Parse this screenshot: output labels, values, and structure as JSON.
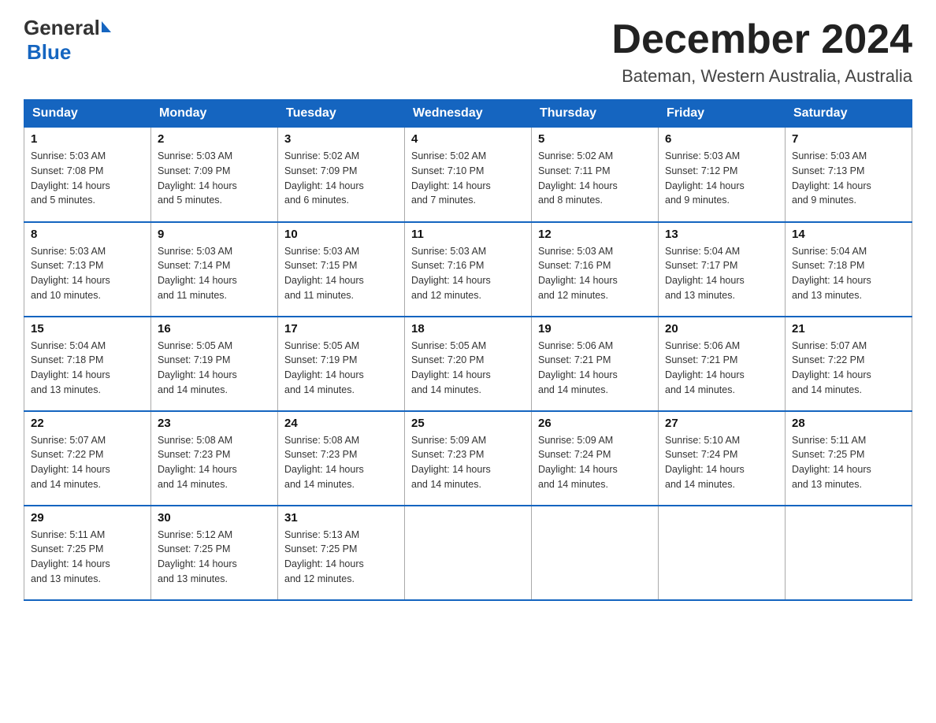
{
  "logo": {
    "general": "General",
    "blue": "Blue"
  },
  "header": {
    "month_title": "December 2024",
    "location": "Bateman, Western Australia, Australia"
  },
  "days_of_week": [
    "Sunday",
    "Monday",
    "Tuesday",
    "Wednesday",
    "Thursday",
    "Friday",
    "Saturday"
  ],
  "weeks": [
    [
      {
        "day": "1",
        "sunrise": "5:03 AM",
        "sunset": "7:08 PM",
        "daylight": "14 hours and 5 minutes."
      },
      {
        "day": "2",
        "sunrise": "5:03 AM",
        "sunset": "7:09 PM",
        "daylight": "14 hours and 5 minutes."
      },
      {
        "day": "3",
        "sunrise": "5:02 AM",
        "sunset": "7:09 PM",
        "daylight": "14 hours and 6 minutes."
      },
      {
        "day": "4",
        "sunrise": "5:02 AM",
        "sunset": "7:10 PM",
        "daylight": "14 hours and 7 minutes."
      },
      {
        "day": "5",
        "sunrise": "5:02 AM",
        "sunset": "7:11 PM",
        "daylight": "14 hours and 8 minutes."
      },
      {
        "day": "6",
        "sunrise": "5:03 AM",
        "sunset": "7:12 PM",
        "daylight": "14 hours and 9 minutes."
      },
      {
        "day": "7",
        "sunrise": "5:03 AM",
        "sunset": "7:13 PM",
        "daylight": "14 hours and 9 minutes."
      }
    ],
    [
      {
        "day": "8",
        "sunrise": "5:03 AM",
        "sunset": "7:13 PM",
        "daylight": "14 hours and 10 minutes."
      },
      {
        "day": "9",
        "sunrise": "5:03 AM",
        "sunset": "7:14 PM",
        "daylight": "14 hours and 11 minutes."
      },
      {
        "day": "10",
        "sunrise": "5:03 AM",
        "sunset": "7:15 PM",
        "daylight": "14 hours and 11 minutes."
      },
      {
        "day": "11",
        "sunrise": "5:03 AM",
        "sunset": "7:16 PM",
        "daylight": "14 hours and 12 minutes."
      },
      {
        "day": "12",
        "sunrise": "5:03 AM",
        "sunset": "7:16 PM",
        "daylight": "14 hours and 12 minutes."
      },
      {
        "day": "13",
        "sunrise": "5:04 AM",
        "sunset": "7:17 PM",
        "daylight": "14 hours and 13 minutes."
      },
      {
        "day": "14",
        "sunrise": "5:04 AM",
        "sunset": "7:18 PM",
        "daylight": "14 hours and 13 minutes."
      }
    ],
    [
      {
        "day": "15",
        "sunrise": "5:04 AM",
        "sunset": "7:18 PM",
        "daylight": "14 hours and 13 minutes."
      },
      {
        "day": "16",
        "sunrise": "5:05 AM",
        "sunset": "7:19 PM",
        "daylight": "14 hours and 14 minutes."
      },
      {
        "day": "17",
        "sunrise": "5:05 AM",
        "sunset": "7:19 PM",
        "daylight": "14 hours and 14 minutes."
      },
      {
        "day": "18",
        "sunrise": "5:05 AM",
        "sunset": "7:20 PM",
        "daylight": "14 hours and 14 minutes."
      },
      {
        "day": "19",
        "sunrise": "5:06 AM",
        "sunset": "7:21 PM",
        "daylight": "14 hours and 14 minutes."
      },
      {
        "day": "20",
        "sunrise": "5:06 AM",
        "sunset": "7:21 PM",
        "daylight": "14 hours and 14 minutes."
      },
      {
        "day": "21",
        "sunrise": "5:07 AM",
        "sunset": "7:22 PM",
        "daylight": "14 hours and 14 minutes."
      }
    ],
    [
      {
        "day": "22",
        "sunrise": "5:07 AM",
        "sunset": "7:22 PM",
        "daylight": "14 hours and 14 minutes."
      },
      {
        "day": "23",
        "sunrise": "5:08 AM",
        "sunset": "7:23 PM",
        "daylight": "14 hours and 14 minutes."
      },
      {
        "day": "24",
        "sunrise": "5:08 AM",
        "sunset": "7:23 PM",
        "daylight": "14 hours and 14 minutes."
      },
      {
        "day": "25",
        "sunrise": "5:09 AM",
        "sunset": "7:23 PM",
        "daylight": "14 hours and 14 minutes."
      },
      {
        "day": "26",
        "sunrise": "5:09 AM",
        "sunset": "7:24 PM",
        "daylight": "14 hours and 14 minutes."
      },
      {
        "day": "27",
        "sunrise": "5:10 AM",
        "sunset": "7:24 PM",
        "daylight": "14 hours and 14 minutes."
      },
      {
        "day": "28",
        "sunrise": "5:11 AM",
        "sunset": "7:25 PM",
        "daylight": "14 hours and 13 minutes."
      }
    ],
    [
      {
        "day": "29",
        "sunrise": "5:11 AM",
        "sunset": "7:25 PM",
        "daylight": "14 hours and 13 minutes."
      },
      {
        "day": "30",
        "sunrise": "5:12 AM",
        "sunset": "7:25 PM",
        "daylight": "14 hours and 13 minutes."
      },
      {
        "day": "31",
        "sunrise": "5:13 AM",
        "sunset": "7:25 PM",
        "daylight": "14 hours and 12 minutes."
      },
      null,
      null,
      null,
      null
    ]
  ]
}
